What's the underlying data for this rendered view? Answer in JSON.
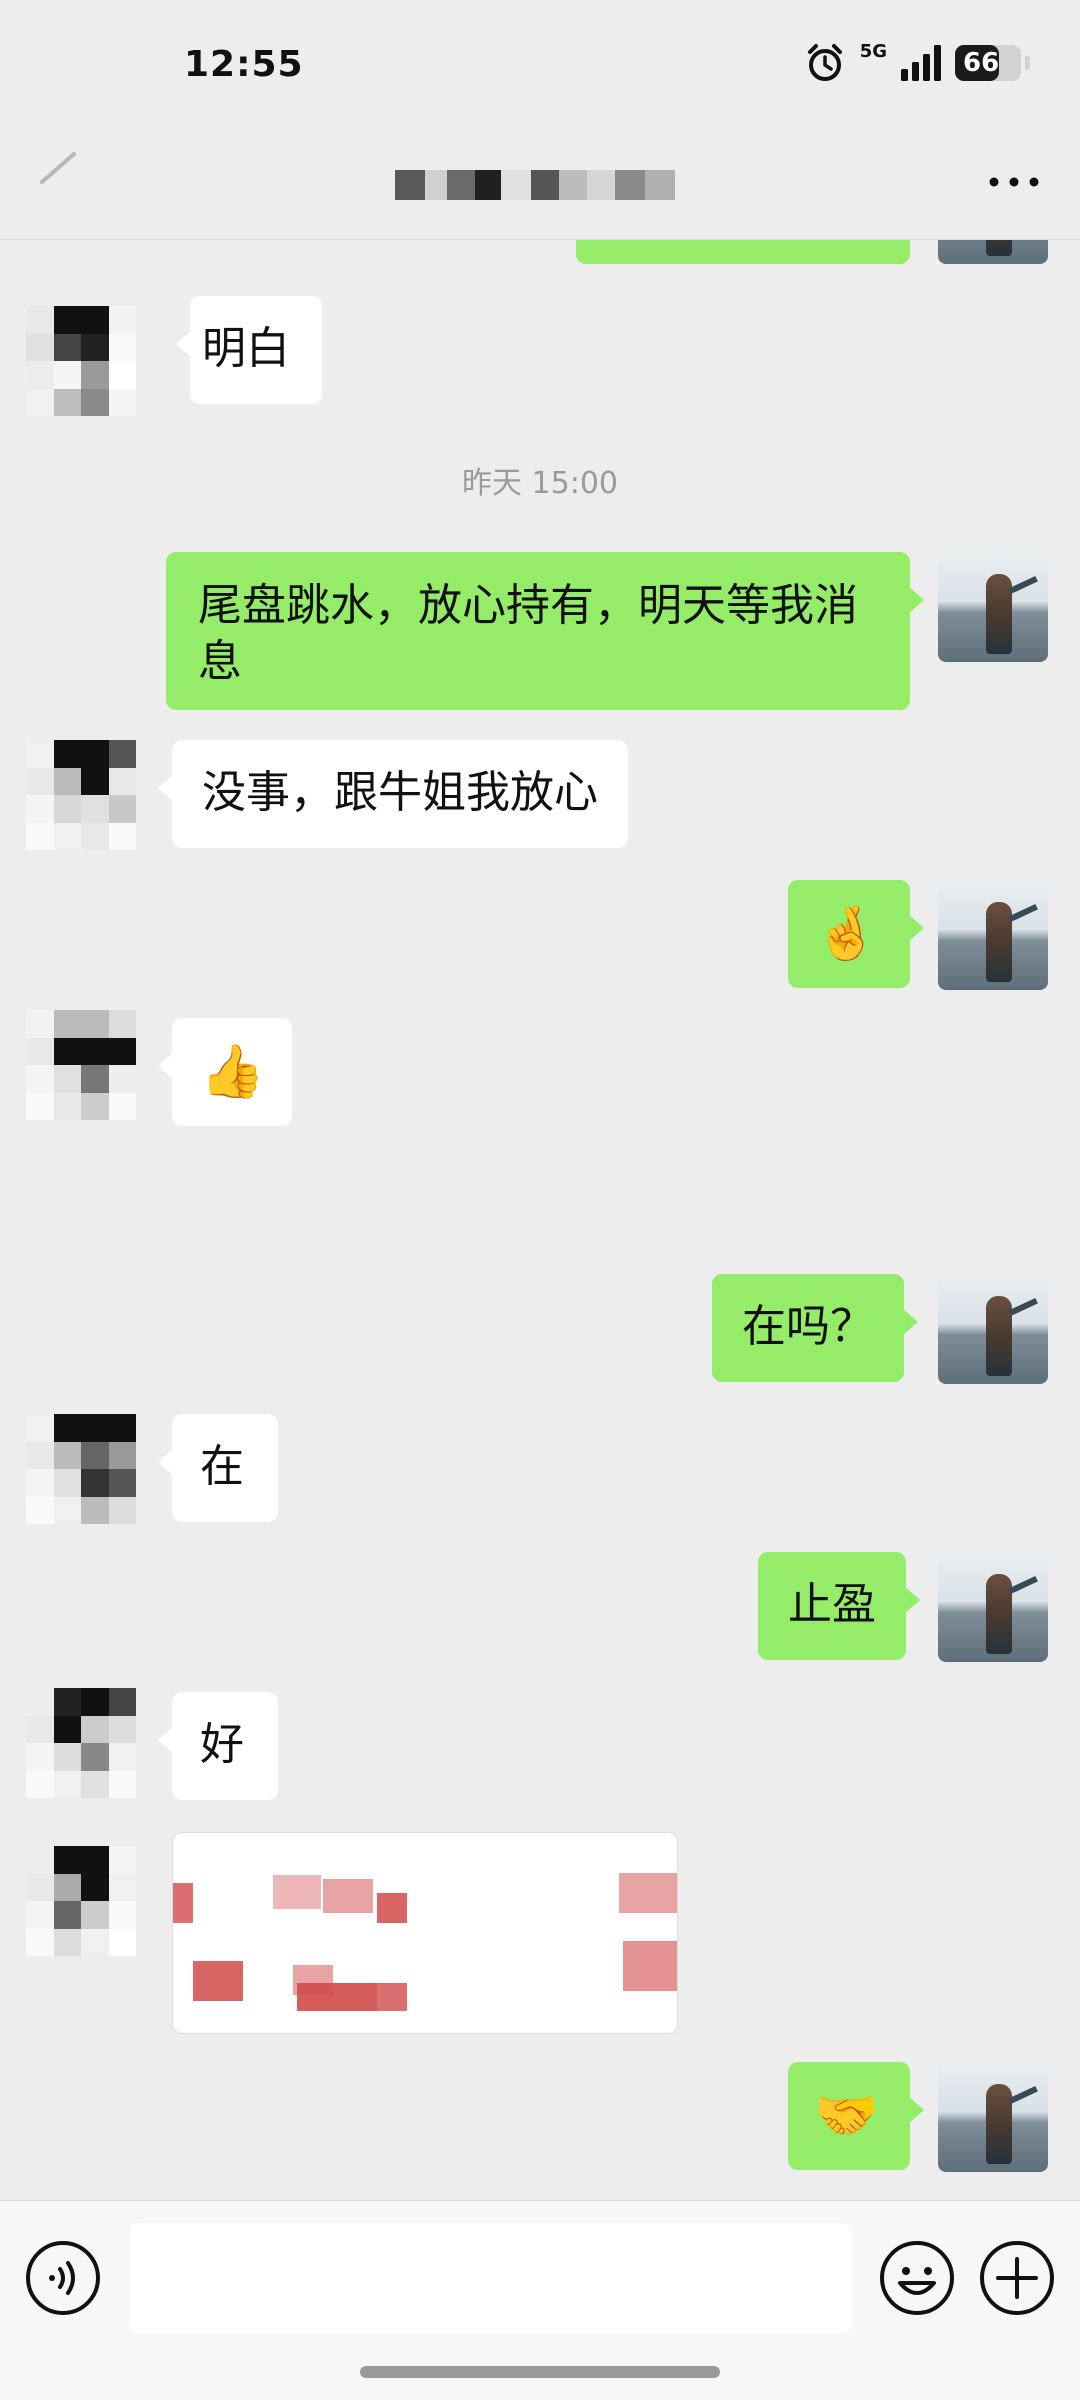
{
  "status_bar": {
    "time": "12:55",
    "network": "5G",
    "battery": "66",
    "battery_level": 0.66
  },
  "nav": {
    "back_icon": "back-arrow-icon",
    "more_icon": "more-icon"
  },
  "messages": [
    {
      "side": "out",
      "type": "text",
      "text": ""
    },
    {
      "side": "in",
      "type": "text",
      "text": "明白"
    },
    {
      "side": "system",
      "type": "time",
      "text": "昨天 15:00"
    },
    {
      "side": "out",
      "type": "text",
      "text": "尾盘跳水，放心持有，明天等我消息"
    },
    {
      "side": "in",
      "type": "text",
      "text": "没事，跟牛姐我放心"
    },
    {
      "side": "out",
      "type": "emoji",
      "text": "🤞"
    },
    {
      "side": "in",
      "type": "emoji",
      "text": "👍"
    },
    {
      "side": "out",
      "type": "text",
      "text": "在吗？"
    },
    {
      "side": "in",
      "type": "text",
      "text": "在"
    },
    {
      "side": "out",
      "type": "text",
      "text": "止盈"
    },
    {
      "side": "in",
      "type": "text",
      "text": "好"
    },
    {
      "side": "in",
      "type": "image",
      "text": ""
    },
    {
      "side": "out",
      "type": "emoji",
      "text": "🤝"
    }
  ],
  "input_bar": {
    "voice_icon": "voice-icon",
    "message_value": "",
    "emoji_icon": "emoji-icon",
    "plus_icon": "plus-icon"
  },
  "colors": {
    "background": "#ededed",
    "outgoing_bubble": "#95ec69",
    "incoming_bubble": "#ffffff"
  }
}
